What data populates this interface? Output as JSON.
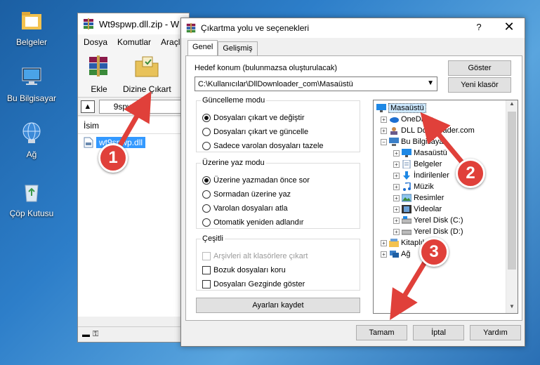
{
  "desktop": {
    "icons": [
      {
        "label": "Belgeler"
      },
      {
        "label": "Bu Bilgisayar"
      },
      {
        "label": "Ağ"
      },
      {
        "label": "Çöp Kutusu"
      }
    ]
  },
  "winrar": {
    "title": "Wt9spwp.dll.zip - W",
    "menu": [
      "Dosya",
      "Komutlar",
      "Araçla"
    ],
    "toolbar": {
      "add_label": "Ekle",
      "extract_label": "Dizine Çıkart"
    },
    "path_value": "9spwp.d",
    "list_header": "İsim",
    "file_name": "wt9spwp.dll"
  },
  "dialog": {
    "title": "Çıkartma yolu ve seçenekleri",
    "help": "?",
    "close": "✕",
    "tabs": [
      "Genel",
      "Gelişmiş"
    ],
    "dest_label": "Hedef konum (bulunmazsa oluşturulacak)",
    "dest_value": "C:\\Kullanıcılar\\DllDownloader_com\\Masaüstü",
    "show_button": "Göster",
    "new_folder_button": "Yeni klasör",
    "update_mode": {
      "legend": "Güncelleme modu",
      "options": [
        "Dosyaları çıkart ve değiştir",
        "Dosyaları çıkart ve güncelle",
        "Sadece varolan dosyaları tazele"
      ],
      "selected": 0
    },
    "overwrite_mode": {
      "legend": "Üzerine yaz modu",
      "options": [
        "Üzerine yazmadan önce sor",
        "Sormadan üzerine yaz",
        "Varolan dosyaları atla",
        "Otomatik yeniden adlandır"
      ],
      "selected": 0
    },
    "misc": {
      "legend": "Çeşitli",
      "options": [
        "Arşivleri alt klasörlere çıkart",
        "Bozuk dosyaları koru",
        "Dosyaları Gezginde göster"
      ]
    },
    "save_settings_button": "Ayarları kaydet",
    "tree": [
      {
        "label": "Masaüstü",
        "icon": "desktop-icon",
        "selected": true
      },
      {
        "label": "OneDrive",
        "icon": "cloud-icon"
      },
      {
        "label": "DLL Downloader.com",
        "icon": "user-icon"
      },
      {
        "label": "Bu Bilgisayar",
        "icon": "computer-icon"
      },
      {
        "label": "Masaüstü",
        "icon": "desktop-icon"
      },
      {
        "label": "Belgeler",
        "icon": "documents-icon"
      },
      {
        "label": "İndirilenler",
        "icon": "download-icon"
      },
      {
        "label": "Müzik",
        "icon": "music-icon"
      },
      {
        "label": "Resimler",
        "icon": "pictures-icon"
      },
      {
        "label": "Videolar",
        "icon": "video-icon"
      },
      {
        "label": "Yerel Disk (C:)",
        "icon": "disk-icon"
      },
      {
        "label": "Yerel Disk (D:)",
        "icon": "disk-icon"
      },
      {
        "label": "Kitaplıklar",
        "icon": "library-icon"
      },
      {
        "label": "Ağ",
        "icon": "network-icon"
      }
    ],
    "ok_button": "Tamam",
    "cancel_button": "İptal",
    "help_button": "Yardım"
  },
  "markers": [
    "1",
    "2",
    "3"
  ],
  "colors": {
    "marker": "#e0403a",
    "selection": "#3399ff",
    "desktop": "#2d7ec9"
  }
}
